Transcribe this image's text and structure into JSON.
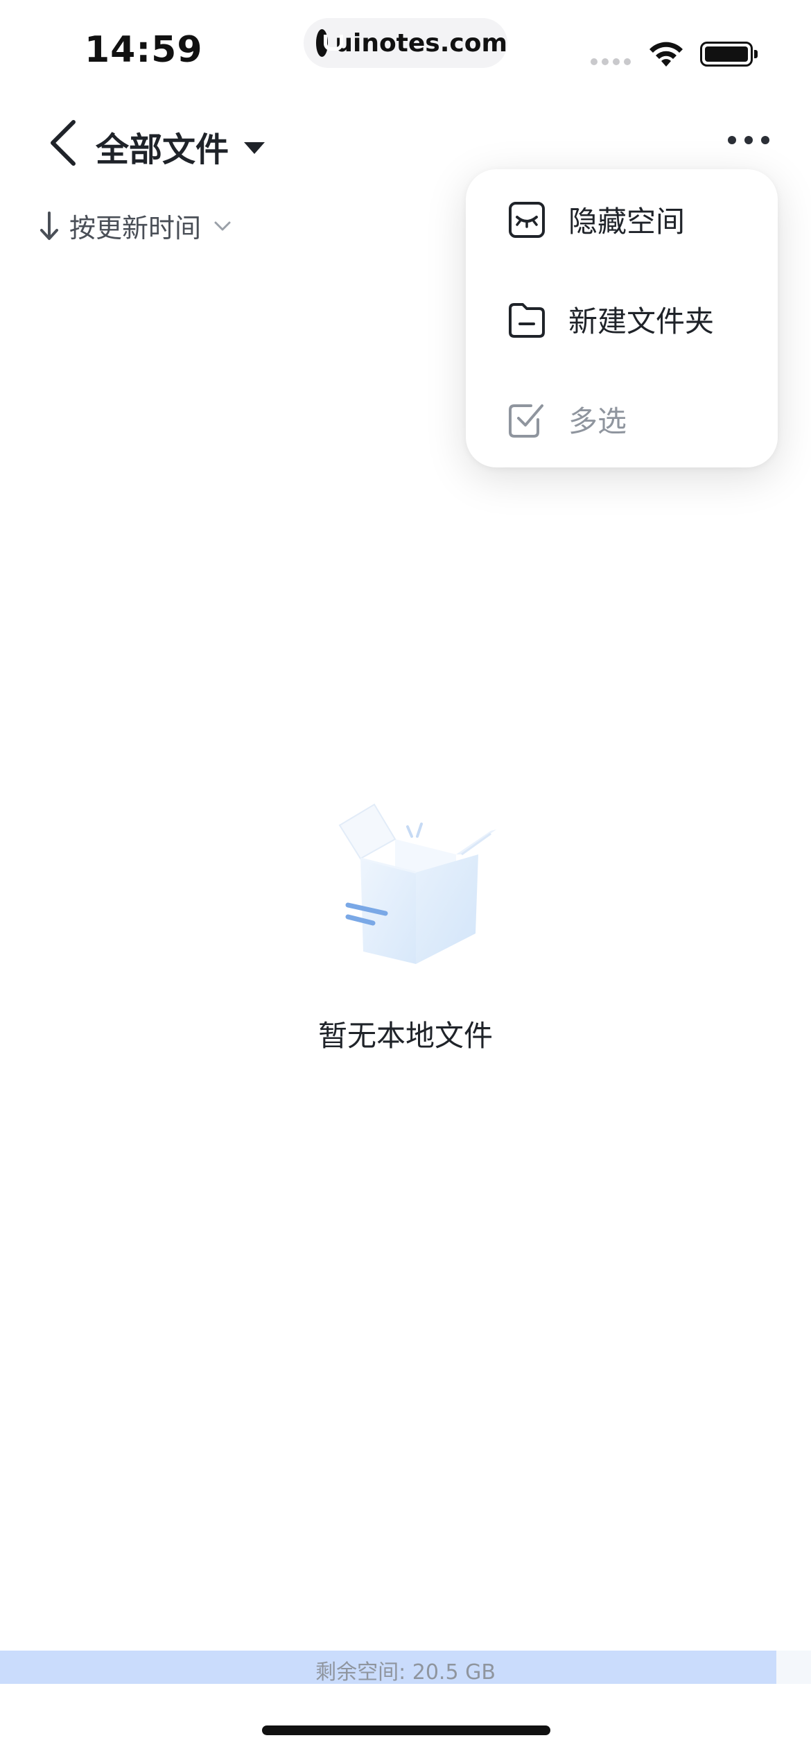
{
  "status_bar": {
    "time": "14:59",
    "url": "uinotes.com",
    "icons": [
      "signal-icon",
      "wifi-icon",
      "battery-icon"
    ]
  },
  "header": {
    "title": "全部文件",
    "back_icon": "chevron-left-icon",
    "title_dropdown_icon": "caret-down-icon",
    "more_icon": "more-horizontal-icon"
  },
  "sort": {
    "label": "按更新时间",
    "direction_icon": "arrow-down-icon",
    "dropdown_icon": "chevron-down-icon"
  },
  "menu": {
    "items": [
      {
        "label": "隐藏空间",
        "icon": "closed-eye-icon",
        "enabled": true
      },
      {
        "label": "新建文件夹",
        "icon": "folder-icon",
        "enabled": true
      },
      {
        "label": "多选",
        "icon": "checkbox-icon",
        "enabled": false
      }
    ]
  },
  "empty_state": {
    "illustration": "empty-box-icon",
    "message": "暂无本地文件"
  },
  "storage": {
    "label": "剩余空间: 20.5 GB",
    "used_fraction": 0.957,
    "fill_color": "#cadcfc"
  }
}
